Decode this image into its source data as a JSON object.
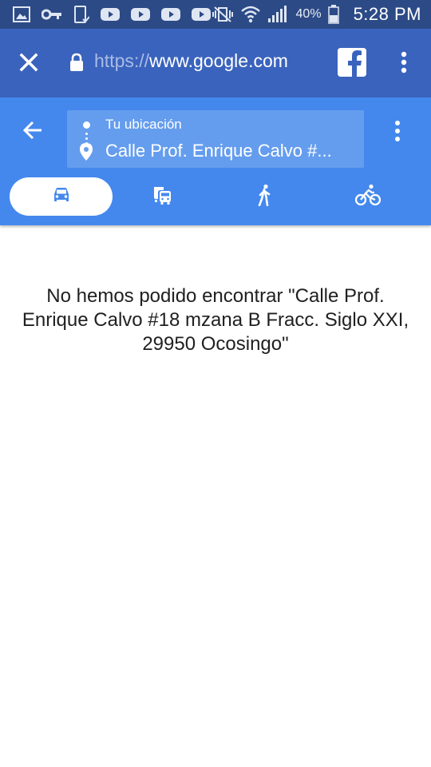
{
  "status_bar": {
    "battery_percent": "40%",
    "time": "5:28 PM",
    "icons": [
      "gallery-icon",
      "vpn-key-icon",
      "device-icon",
      "youtube-icon",
      "youtube-icon",
      "youtube-icon",
      "youtube-icon",
      "vibrate-off-icon",
      "wifi-icon",
      "signal-icon",
      "battery-icon"
    ]
  },
  "custom_tab": {
    "url_scheme": "https://",
    "url_host": "www.google.com",
    "icons": [
      "close-icon",
      "lock-icon",
      "facebook-icon",
      "more-vert-icon"
    ]
  },
  "directions": {
    "origin": "Tu ubicación",
    "destination": "Calle Prof. Enrique Calvo #...",
    "travel_modes": [
      {
        "name": "car",
        "icon": "car-icon",
        "selected": true
      },
      {
        "name": "transit",
        "icon": "transit-icon",
        "selected": false
      },
      {
        "name": "walk",
        "icon": "walk-icon",
        "selected": false
      },
      {
        "name": "bike",
        "icon": "bike-icon",
        "selected": false
      }
    ]
  },
  "message": {
    "line1": "No hemos podido encontrar \"Calle Prof.",
    "line2": "Enrique Calvo #18 mzana B Fracc. Siglo XXI,",
    "line3": "29950 Ocosingo\""
  },
  "colors": {
    "status_bar": "#2c4a86",
    "tab_bar": "#3a63bd",
    "maps_header": "#4488ee",
    "route_box": "#659dee",
    "mode_icon": "#4488ee"
  }
}
